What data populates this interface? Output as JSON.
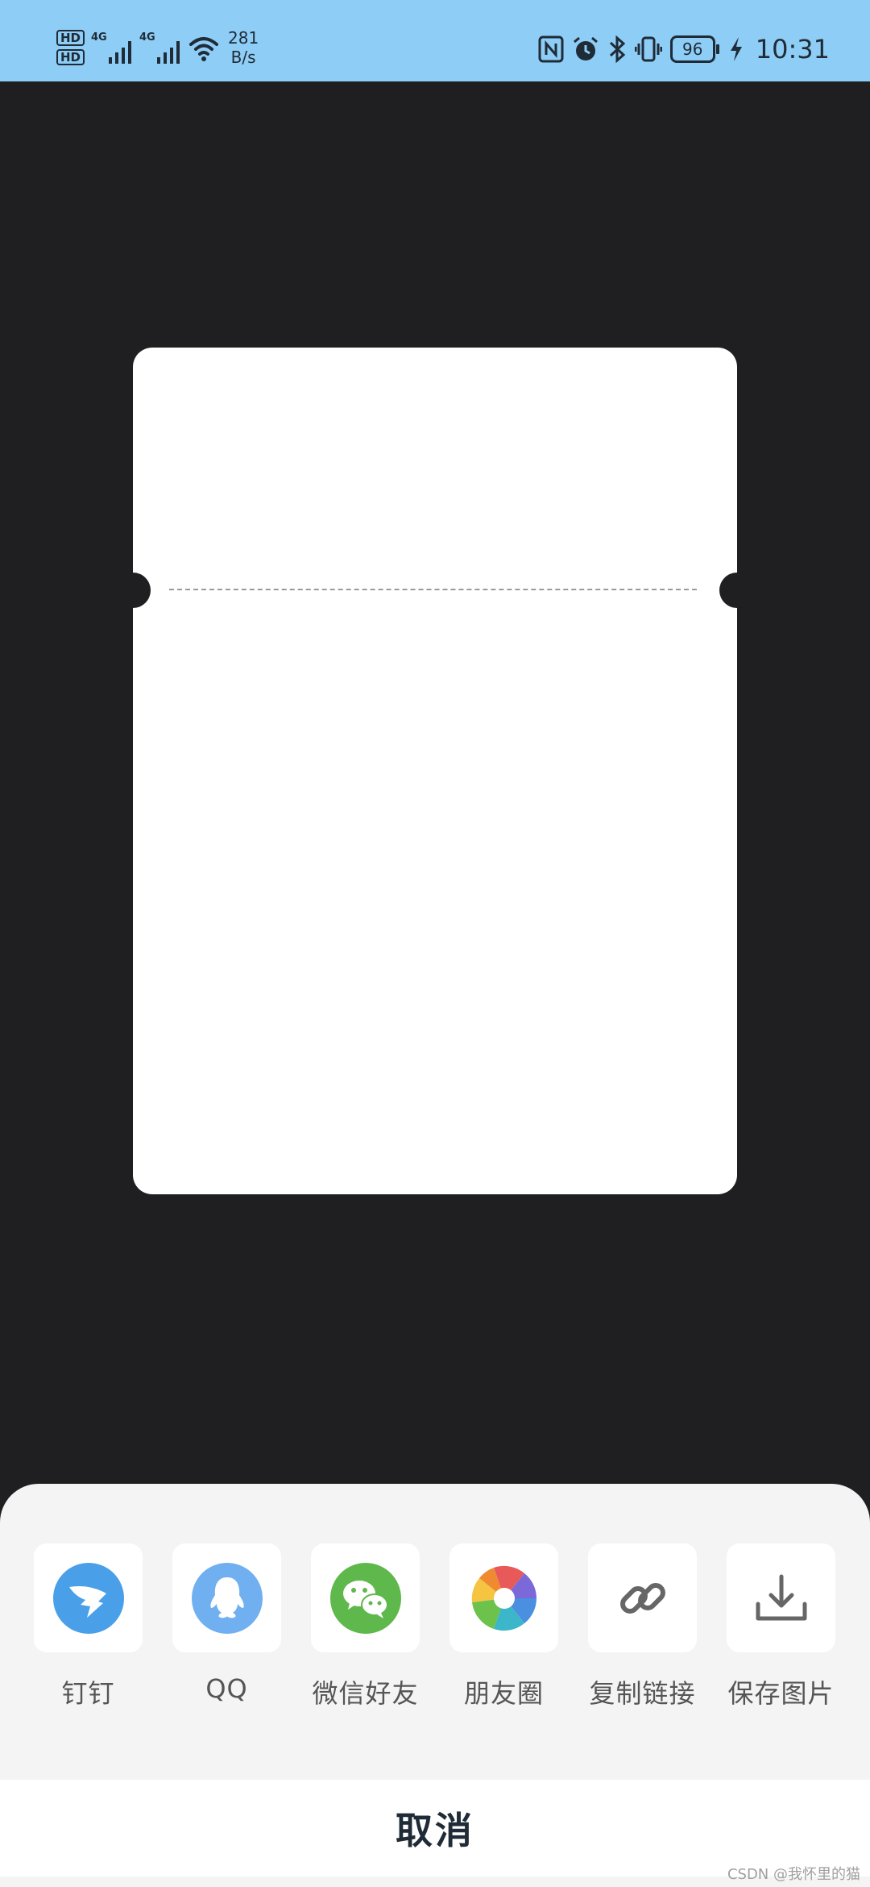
{
  "status_bar": {
    "sim1_label": "HD",
    "sim2_label": "HD",
    "network1": "4G",
    "network2": "4G",
    "speed_value": "281",
    "speed_unit": "B/s",
    "battery_level": "96",
    "time": "10:31",
    "icons": [
      "nfc-icon",
      "alarm-icon",
      "bluetooth-icon",
      "vibrate-icon",
      "battery-icon",
      "charging-icon"
    ]
  },
  "share_sheet": {
    "items": [
      {
        "label": "钉钉",
        "icon": "dingtalk-icon",
        "color": "#4a9fe9"
      },
      {
        "label": "QQ",
        "icon": "qq-icon",
        "color": "#70aff0"
      },
      {
        "label": "微信好友",
        "icon": "wechat-icon",
        "color": "#5fb84c"
      },
      {
        "label": "朋友圈",
        "icon": "moments-icon",
        "color": "#f0a030"
      },
      {
        "label": "复制链接",
        "icon": "link-icon",
        "color": "#666666"
      },
      {
        "label": "保存图片",
        "icon": "download-icon",
        "color": "#666666"
      }
    ],
    "cancel_label": "取消"
  },
  "watermark": "CSDN @我怀里的猫",
  "colors": {
    "status_bar_bg": "#8ecdf6",
    "page_bg": "#1f1f21",
    "sheet_bg": "#f4f4f4",
    "ticket_bg": "#ffffff"
  }
}
